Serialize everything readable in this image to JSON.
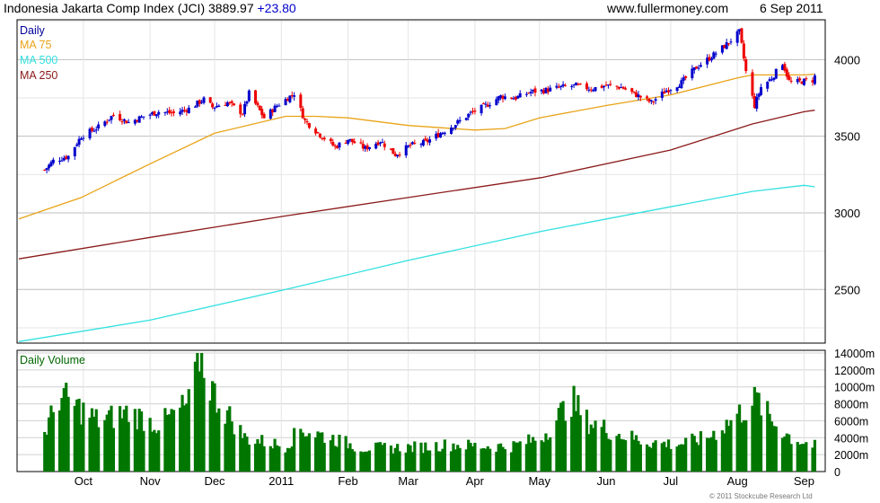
{
  "header": {
    "index_name": "Indonesia Jakarta Comp Index (JCI)",
    "last_value": "3889.97",
    "change": "+23.80",
    "website": "www.fullermoney.com",
    "date": "6 Sep 2011"
  },
  "copyright": "© 2011 Stockcube Research Ltd",
  "colors": {
    "up_candle": "#0000cc",
    "down_candle": "#ee0000",
    "daily_label": "#000099",
    "ma75": "#e8a317",
    "ma500": "#33e0e0",
    "ma250": "#8b1a1a",
    "volume": "#007700",
    "grid": "#bfbfbf"
  },
  "chart_data": [
    {
      "type": "candlestick",
      "panel": "price",
      "legend": [
        {
          "label": "Daily",
          "color": "#000099"
        },
        {
          "label": "MA 75",
          "color": "#e8a317"
        },
        {
          "label": "MA 500",
          "color": "#33e0e0"
        },
        {
          "label": "MA 250",
          "color": "#8b1a1a"
        }
      ],
      "legend_position": "top-left",
      "x_tick_labels": [
        "Oct",
        "Nov",
        "Dec",
        "2011",
        "Feb",
        "Mar",
        "Apr",
        "May",
        "Jun",
        "Jul",
        "Aug",
        "Sep"
      ],
      "x_tick_dates": [
        "2010-10-01",
        "2010-11-01",
        "2010-12-01",
        "2011-01-01",
        "2011-02-01",
        "2011-03-01",
        "2011-04-01",
        "2011-05-01",
        "2011-06-01",
        "2011-07-01",
        "2011-08-01",
        "2011-09-01"
      ],
      "y_ticks": [
        2500,
        3000,
        3500,
        4000
      ],
      "ylim": [
        2150,
        4260
      ],
      "grid": true,
      "close_path": [
        [
          "2010-09-13",
          3280
        ],
        [
          "2010-09-17",
          3340
        ],
        [
          "2010-09-24",
          3370
        ],
        [
          "2010-09-30",
          3500
        ],
        [
          "2010-10-08",
          3560
        ],
        [
          "2010-10-15",
          3640
        ],
        [
          "2010-10-22",
          3590
        ],
        [
          "2010-10-29",
          3630
        ],
        [
          "2010-11-05",
          3660
        ],
        [
          "2010-11-12",
          3650
        ],
        [
          "2010-11-19",
          3680
        ],
        [
          "2010-11-26",
          3740
        ],
        [
          "2010-11-30",
          3690
        ],
        [
          "2010-12-07",
          3720
        ],
        [
          "2010-12-14",
          3650
        ],
        [
          "2010-12-17",
          3780
        ],
        [
          "2010-12-24",
          3620
        ],
        [
          "2010-12-30",
          3700
        ],
        [
          "2011-01-07",
          3780
        ],
        [
          "2011-01-12",
          3600
        ],
        [
          "2011-01-19",
          3510
        ],
        [
          "2011-01-26",
          3430
        ],
        [
          "2011-02-01",
          3480
        ],
        [
          "2011-02-09",
          3420
        ],
        [
          "2011-02-16",
          3470
        ],
        [
          "2011-02-23",
          3380
        ],
        [
          "2011-03-02",
          3440
        ],
        [
          "2011-03-09",
          3460
        ],
        [
          "2011-03-16",
          3520
        ],
        [
          "2011-03-23",
          3580
        ],
        [
          "2011-03-30",
          3650
        ],
        [
          "2011-04-06",
          3700
        ],
        [
          "2011-04-13",
          3760
        ],
        [
          "2011-04-20",
          3750
        ],
        [
          "2011-04-27",
          3790
        ],
        [
          "2011-05-04",
          3800
        ],
        [
          "2011-05-11",
          3820
        ],
        [
          "2011-05-18",
          3830
        ],
        [
          "2011-05-25",
          3810
        ],
        [
          "2011-06-01",
          3830
        ],
        [
          "2011-06-08",
          3820
        ],
        [
          "2011-06-15",
          3770
        ],
        [
          "2011-06-22",
          3720
        ],
        [
          "2011-06-29",
          3800
        ],
        [
          "2011-07-06",
          3850
        ],
        [
          "2011-07-13",
          3950
        ],
        [
          "2011-07-20",
          4020
        ],
        [
          "2011-07-27",
          4100
        ],
        [
          "2011-08-02",
          4180
        ],
        [
          "2011-08-05",
          3920
        ],
        [
          "2011-08-09",
          3700
        ],
        [
          "2011-08-12",
          3820
        ],
        [
          "2011-08-17",
          3880
        ],
        [
          "2011-08-22",
          3980
        ],
        [
          "2011-08-25",
          3860
        ],
        [
          "2011-08-26",
          3850
        ],
        [
          "2011-09-05",
          3866
        ],
        [
          "2011-09-06",
          3890
        ]
      ],
      "ma75_path": [
        [
          "2010-09-01",
          2960
        ],
        [
          "2010-09-30",
          3100
        ],
        [
          "2010-11-01",
          3320
        ],
        [
          "2010-12-01",
          3520
        ],
        [
          "2011-01-03",
          3630
        ],
        [
          "2011-01-17",
          3630
        ],
        [
          "2011-02-01",
          3620
        ],
        [
          "2011-03-01",
          3570
        ],
        [
          "2011-04-01",
          3540
        ],
        [
          "2011-04-15",
          3550
        ],
        [
          "2011-05-01",
          3620
        ],
        [
          "2011-06-01",
          3700
        ],
        [
          "2011-07-01",
          3770
        ],
        [
          "2011-08-01",
          3880
        ],
        [
          "2011-08-08",
          3900
        ],
        [
          "2011-09-01",
          3900
        ],
        [
          "2011-09-06",
          3905
        ]
      ],
      "ma250_path": [
        [
          "2010-09-01",
          2700
        ],
        [
          "2010-11-01",
          2840
        ],
        [
          "2011-01-03",
          2980
        ],
        [
          "2011-03-01",
          3100
        ],
        [
          "2011-05-02",
          3230
        ],
        [
          "2011-07-01",
          3410
        ],
        [
          "2011-08-08",
          3580
        ],
        [
          "2011-09-01",
          3660
        ],
        [
          "2011-09-06",
          3670
        ]
      ],
      "ma500_path": [
        [
          "2010-09-01",
          2160
        ],
        [
          "2010-11-01",
          2300
        ],
        [
          "2011-01-03",
          2500
        ],
        [
          "2011-03-01",
          2690
        ],
        [
          "2011-05-02",
          2880
        ],
        [
          "2011-07-01",
          3040
        ],
        [
          "2011-08-08",
          3140
        ],
        [
          "2011-09-01",
          3180
        ],
        [
          "2011-09-06",
          3170
        ]
      ]
    },
    {
      "type": "bar",
      "panel": "volume",
      "title": "Daily Volume",
      "y_ticks": [
        0,
        2000,
        4000,
        6000,
        8000,
        10000,
        12000,
        14000
      ],
      "y_tick_labels": [
        "0",
        "2000m",
        "4000m",
        "6000m",
        "8000m",
        "10000m",
        "12000m",
        "14000m"
      ],
      "ylim": [
        0,
        14000
      ],
      "grid": true,
      "profile": [
        [
          "2010-09-13",
          4500
        ],
        [
          "2010-09-20",
          9000
        ],
        [
          "2010-10-08",
          6000
        ],
        [
          "2010-10-22",
          7000
        ],
        [
          "2010-11-05",
          5500
        ],
        [
          "2010-11-19",
          8000
        ],
        [
          "2010-11-24",
          14000
        ],
        [
          "2010-12-01",
          9000
        ],
        [
          "2010-12-15",
          4000
        ],
        [
          "2011-01-03",
          3000
        ],
        [
          "2011-01-10",
          5000
        ],
        [
          "2011-01-24",
          4000
        ],
        [
          "2011-02-07",
          2800
        ],
        [
          "2011-02-21",
          2800
        ],
        [
          "2011-03-07",
          2900
        ],
        [
          "2011-03-21",
          3200
        ],
        [
          "2011-04-04",
          3000
        ],
        [
          "2011-04-18",
          3000
        ],
        [
          "2011-05-02",
          4000
        ],
        [
          "2011-05-16",
          8500
        ],
        [
          "2011-05-23",
          6000
        ],
        [
          "2011-06-06",
          4500
        ],
        [
          "2011-06-20",
          3500
        ],
        [
          "2011-07-04",
          3200
        ],
        [
          "2011-07-18",
          4000
        ],
        [
          "2011-07-29",
          6000
        ],
        [
          "2011-08-05",
          7500
        ],
        [
          "2011-08-10",
          8500
        ],
        [
          "2011-08-17",
          6000
        ],
        [
          "2011-08-26",
          4000
        ],
        [
          "2011-09-06",
          3000
        ]
      ]
    }
  ]
}
